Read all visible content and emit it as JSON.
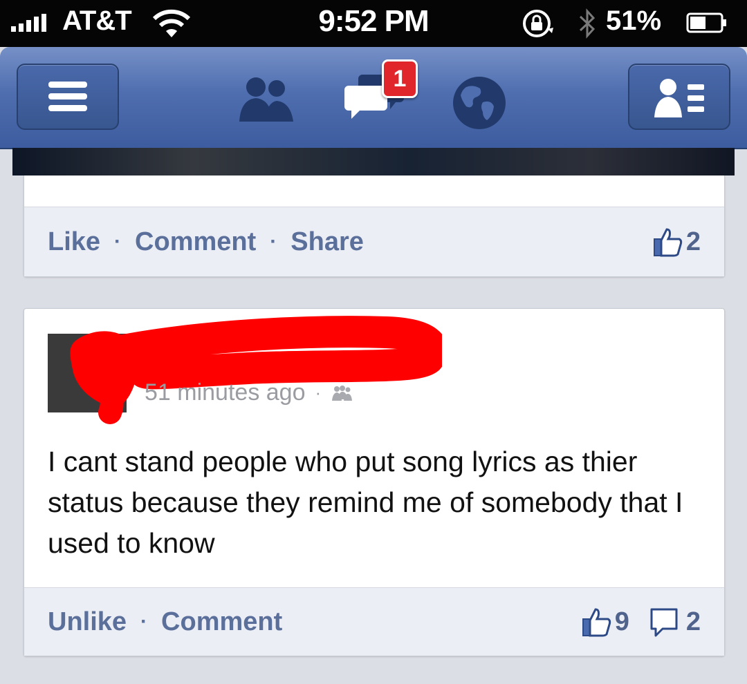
{
  "status_bar": {
    "carrier": "AT&T",
    "time": "9:52 PM",
    "battery_percent": "51%",
    "signal_bars": 5,
    "icons": [
      "signal-icon",
      "wifi-icon",
      "rotation-lock-icon",
      "bluetooth-icon",
      "battery-icon"
    ]
  },
  "nav_bar": {
    "notification_badge": "1",
    "icons": [
      "menu-icon",
      "friend-requests-icon",
      "messages-icon",
      "notifications-globe-icon",
      "contacts-icon"
    ],
    "colors": {
      "bar": "#4f6eaf",
      "badge": "#e0262b"
    }
  },
  "previous_post": {
    "actions": {
      "like": "Like",
      "comment": "Comment",
      "share": "Share",
      "separator": "·"
    },
    "like_count": "2"
  },
  "post": {
    "timestamp": "51 minutes ago",
    "separator": "·",
    "audience_icon": "friends-audience-icon",
    "text": "I cant stand people who put song lyrics as thier status because they remind me of somebody that I used to know",
    "actions": {
      "unlike": "Unlike",
      "comment": "Comment",
      "separator": "·"
    },
    "like_count": "9",
    "comment_count": "2"
  },
  "colors": {
    "link": "#5b6f9b",
    "redaction": "#ff0000",
    "background": "#dcdee5"
  }
}
